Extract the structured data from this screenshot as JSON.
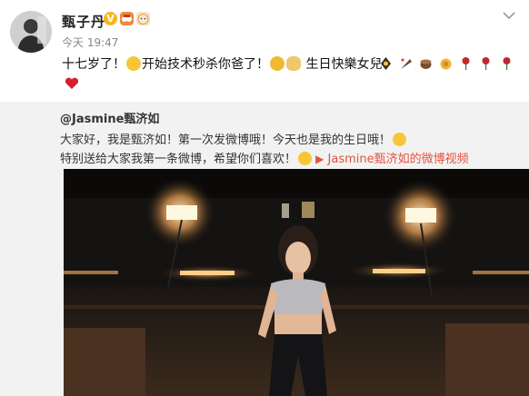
{
  "post": {
    "author": "甄子丹",
    "timestamp": "今天 19:47",
    "text_part1": "十七岁了！",
    "text_part2": "开始技术秒杀你爸了！",
    "text_part3": "生日快樂女兒！",
    "icons": {
      "verified": "verified-badge-icon",
      "member": "member-badge-icon",
      "menu": "chevron-down-icon"
    }
  },
  "repost": {
    "author": "@Jasmine甄济如",
    "line1": "大家好，我是甄济如！第一次发微博哦！今天也是我的生日哦！",
    "line2": "特别送给大家我第一条微博，希望你们喜欢！",
    "video_link": "Jasmine甄济如的微博视频"
  },
  "colors": {
    "link": "#e2533f",
    "verified": "#f5b622",
    "repost_bg": "#f2f2f2"
  }
}
